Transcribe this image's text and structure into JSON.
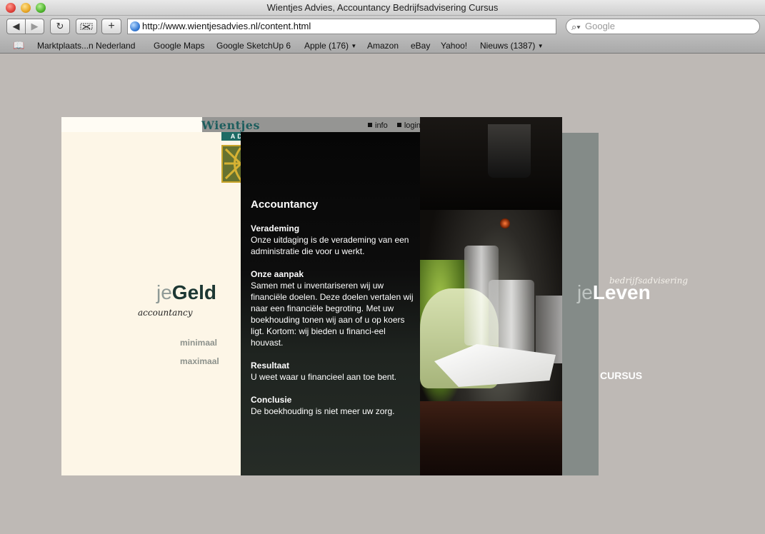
{
  "window": {
    "title": "Wientjes Advies, Accountancy Bedrijfsadvisering Cursus"
  },
  "toolbar": {
    "back": "◀",
    "forward": "▶",
    "reload": "↻",
    "add": "+",
    "url": "http://www.wientjesadvies.nl/content.html",
    "search_placeholder": "Google"
  },
  "bookmarks": [
    "Marktplaats...n Nederland",
    "Google Maps",
    "Google SketchUp 6",
    "Apple (176)",
    "Amazon",
    "eBay",
    "Yahoo!",
    "Nieuws (1387)"
  ],
  "site": {
    "brand": "Wientjes",
    "brand_sub": "ADVIES",
    "nav": {
      "info": "info",
      "login": "login"
    },
    "left": {
      "je": "je",
      "word": "Geld",
      "label": "accountancy",
      "minimaal": "minimaal",
      "maximaal": "maximaal"
    },
    "content": {
      "title": "Accountancy",
      "sections": [
        {
          "heading": "Verademing",
          "text": "Onze uitdaging is de verademing van een administratie die voor u werkt."
        },
        {
          "heading": "Onze aanpak",
          "text": "Samen met u inventariseren wij uw financiële doelen. Deze doelen vertalen wij naar een financiële begroting. Met uw boekhouding tonen wij aan of u op koers ligt. Kortom: wij bieden u financi-eel houvast."
        },
        {
          "heading": "Resultaat",
          "text": "U weet waar u financieel aan toe bent."
        },
        {
          "heading": "Conclusie",
          "text": "De boekhouding is niet meer uw zorg."
        }
      ]
    },
    "right": {
      "label": "bedrijfsadvisering",
      "je": "je",
      "word": "Leven",
      "cursus": "CURSUS"
    }
  }
}
